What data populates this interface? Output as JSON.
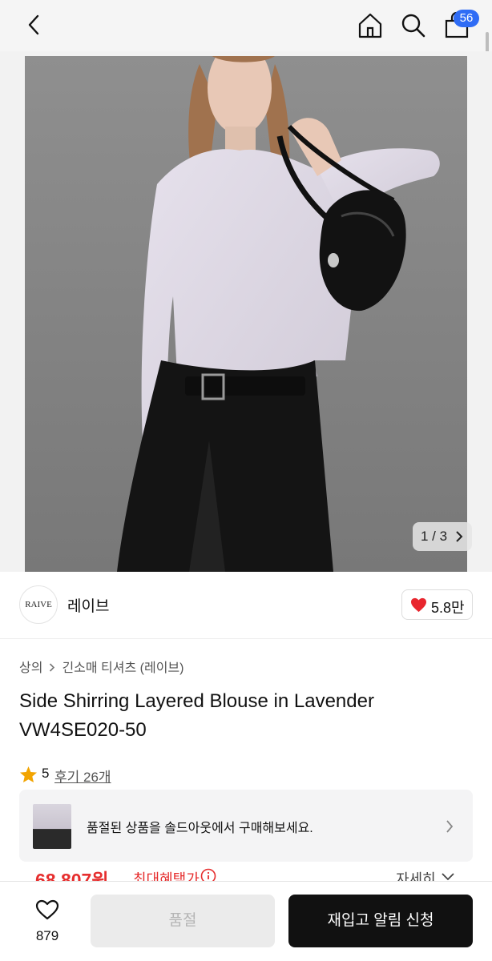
{
  "header": {
    "cart_count": "56",
    "icons": {
      "back": "chevron-left-icon",
      "home": "home-icon",
      "search": "search-icon",
      "cart": "shopping-bag-icon"
    }
  },
  "gallery": {
    "counter": "1 / 3",
    "current": 1,
    "total": 3
  },
  "brand": {
    "logo_text": "RAIVE",
    "name": "레이브",
    "likes": "5.8만"
  },
  "breadcrumb": {
    "category": "상의",
    "subcategory": "긴소매 티셔츠 (레이브)"
  },
  "product": {
    "title": "Side Shirring Layered Blouse in Lavender VW4SE020-50",
    "rating": "5",
    "reviews": "후기 26개"
  },
  "notice": {
    "message": "품절된 상품을 솔드아웃에서 구매해보세요."
  },
  "price": {
    "amount": "68,807원",
    "benefit_label": "최대혜택가",
    "detail_label": "자세히"
  },
  "bottom": {
    "wish_count": "879",
    "soldout_label": "품절",
    "restock_label": "재입고 알림 신청"
  },
  "colors": {
    "accent": "#e62e2e",
    "badge": "#2f6cf5",
    "primary_button": "#111111"
  }
}
